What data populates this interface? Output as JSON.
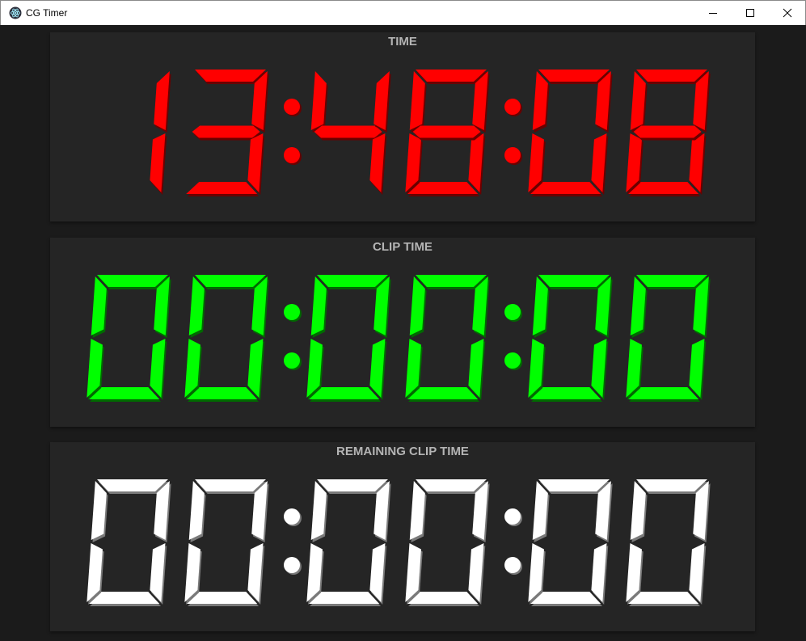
{
  "window": {
    "title": "CG Timer",
    "app_icon": "electron-atom-icon",
    "controls": [
      "minimize-icon",
      "maximize-icon",
      "close-icon"
    ]
  },
  "panels": [
    {
      "title": "TIME",
      "value": "13:48:08",
      "color": "#ff0000",
      "shadow": "#6a0000"
    },
    {
      "title": "CLIP TIME",
      "value": "00:00:00",
      "color": "#00ff00",
      "shadow": "#006a00"
    },
    {
      "title": "REMAINING CLIP TIME",
      "value": "00:00:00",
      "color": "#ffffff",
      "shadow": "#7a7a7a"
    }
  ],
  "colors": {
    "background": "#1b1b1b",
    "panel": "#252525",
    "label": "#b4b4b4"
  }
}
